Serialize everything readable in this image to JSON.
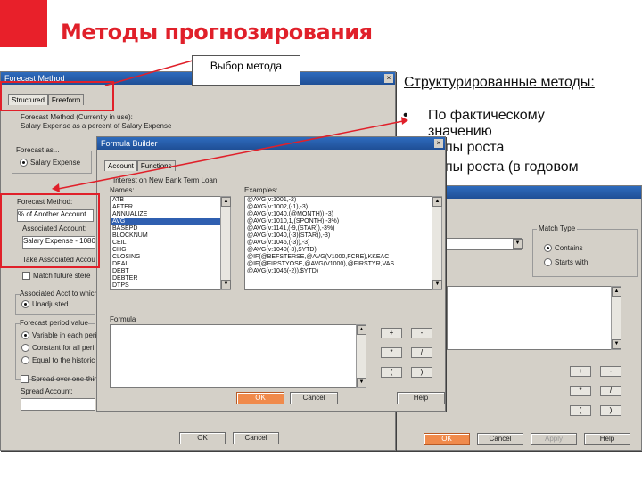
{
  "slide": {
    "title": "Методы прогнозирования",
    "callout": "Выбор метода",
    "structured_title": "Структурированные методы:",
    "bullets": [
      {
        "marker": "•",
        "text": "По фактическому"
      },
      {
        "marker": "",
        "text": "значению"
      },
      {
        "marker": "",
        "text": "мпы роста"
      },
      {
        "marker": "",
        "text": "мпы роста (в годовом"
      }
    ]
  },
  "colors": {
    "accent": "#e0202a",
    "titlebar": "#2e6bbd",
    "ok_button": "#f08a4b"
  },
  "forecast_method": {
    "title": "Forecast Method",
    "tabs": [
      "Structured",
      "Freeform"
    ],
    "method_label": "Forecast Method (Currently in use):",
    "method_value_1": "Salary Expense as a percent of Salary Expense",
    "forecast_as_label": "Forecast as...",
    "forecast_as_option": "Salary Expense",
    "forecast_method_label": "Forecast Method:",
    "forecast_method_value": "% of Another Account",
    "associated_account_label": "Associated Account:",
    "associated_account_value": "Salary Expense - 1080",
    "take_assoc_label": "Take Associated Accou",
    "match_label": "Match future stere",
    "assoc_acct_label": "Associated Acct to which",
    "unadjusted_option": "Unadjusted",
    "forecast_period_label": "Forecast period value",
    "period_options": [
      "Variable in each peri",
      "Constant for all peri",
      "Equal to the historic"
    ],
    "spread_label": "Spread over one-third",
    "spread_account_label": "Spread Account:",
    "ok": "OK",
    "cancel": "Cancel"
  },
  "formula_builder": {
    "title": "Formula Builder",
    "tabs": [
      "Account",
      "Functions"
    ],
    "interest_label": "Interest on New Bank Term Loan",
    "names_label": "Names:",
    "names": [
      "ATB",
      "AFTER",
      "ANNUALIZE",
      "AVG",
      "BASEPD",
      "BLOCKNUM",
      "CEIL",
      "CHG",
      "CLOSING",
      "DEAL",
      "DEBT",
      "DEBTER",
      "DTPS"
    ],
    "selected_name": "AVG",
    "examples_label": "Examples:",
    "examples": [
      "@AVG(v:1001,-2)",
      "@AVG(v:1002,(-1),-3)",
      "@AVG(v:1040,(@MONTH)),-3)",
      "@AVG(v:1010,1,(SPONTH),-3%)",
      "@AVG(v:1141,(-9,(STAR)),-3%)",
      "@AVG(v:1040,(-3)(STAR)),-3)",
      "@AVG(v:1046,(-3)),-3)",
      "@AVG(v:1040(-3),$YTD)",
      "@IF(@BEFSTERSE,@AVG(V1000,FCRE),KKEAC",
      "@IF(@FIRSTYOSE,@AVG(V1000),@FIRSTYR,VAS",
      "@AVG(v:1046(-2)),$YTD)"
    ],
    "formula_label": "Formula",
    "ops": [
      "+",
      "-",
      "*",
      "/",
      "(",
      ")"
    ],
    "ok": "OK",
    "cancel": "Cancel",
    "help": "Help"
  },
  "third_dialog": {
    "match_type_label": "Match Type",
    "contains": "Contains",
    "starts_with": "Starts with",
    "ops": [
      "+",
      "-",
      "*",
      "/",
      "(",
      ")"
    ],
    "ok": "OK",
    "cancel": "Cancel",
    "apply": "Apply",
    "help": "Help"
  }
}
